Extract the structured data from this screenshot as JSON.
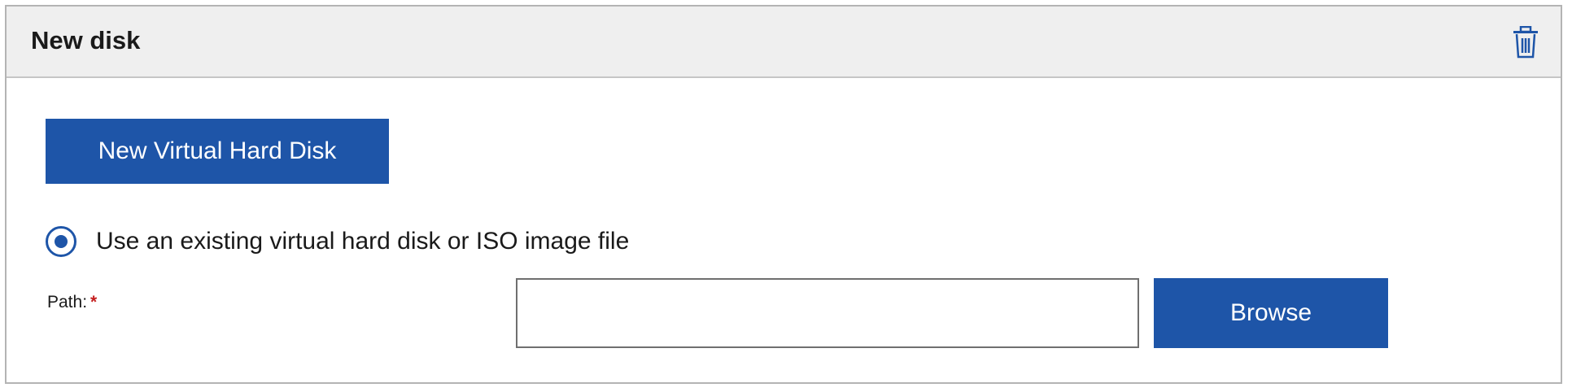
{
  "panel": {
    "title": "New disk",
    "delete_icon": "trash-icon"
  },
  "new_vhd_button": {
    "label": "New Virtual Hard Disk"
  },
  "existing_disk_option": {
    "label": "Use an existing virtual hard disk or ISO image file",
    "selected": true
  },
  "path_field": {
    "label": "Path:",
    "required_marker": "*",
    "value": "",
    "placeholder": ""
  },
  "browse_button": {
    "label": "Browse"
  },
  "colors": {
    "accent": "#1e55a8",
    "required": "#c41e1e",
    "header_background": "#efefef",
    "border": "#b4b4b4"
  }
}
